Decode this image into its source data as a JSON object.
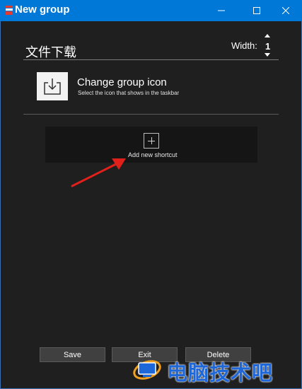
{
  "window": {
    "title": "New group",
    "minimize_glyph": "—",
    "maximize_glyph": "☐",
    "close_glyph": "✕"
  },
  "group": {
    "name": "文件下载",
    "width_label": "Width:",
    "width_value": "1"
  },
  "icon_section": {
    "title": "Change group icon",
    "subtitle": "Select the icon that shows in the taskbar",
    "icon": "download-tray-icon"
  },
  "add_shortcut": {
    "label": "Add new shortcut",
    "icon": "plus-icon"
  },
  "buttons": {
    "save": "Save",
    "exit": "Exit",
    "delete": "Delete"
  },
  "watermark": {
    "text": "电脑技术吧"
  },
  "colors": {
    "titlebar": "#0078d7",
    "background": "#1f1f1f",
    "arrow": "#e0201a",
    "watermark": "#1d67d8"
  }
}
